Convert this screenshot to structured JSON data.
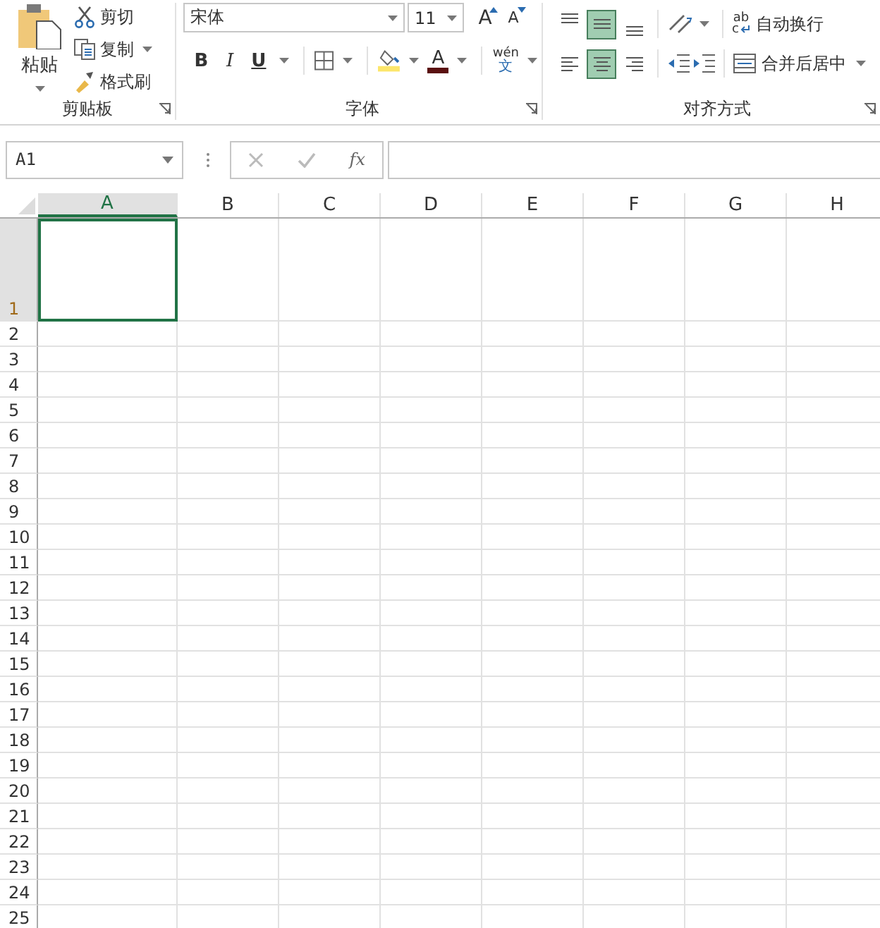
{
  "ribbon": {
    "clipboard": {
      "paste": {
        "label": "粘贴"
      },
      "cut": {
        "label": "剪切"
      },
      "copy": {
        "label": "复制"
      },
      "format_painter": {
        "label": "格式刷"
      },
      "group_label": "剪贴板"
    },
    "font": {
      "font_name": "宋体",
      "font_size": "11",
      "grow": "A",
      "shrink": "A",
      "bold": "B",
      "italic": "I",
      "underline": "U",
      "font_color": "A",
      "phonetic_top": "wén",
      "phonetic_bottom": "文",
      "group_label": "字体"
    },
    "alignment": {
      "vertical": [
        {
          "kind": "top",
          "selected": false
        },
        {
          "kind": "middle",
          "selected": true
        },
        {
          "kind": "bottom",
          "selected": false
        }
      ],
      "horizontal": [
        {
          "kind": "left",
          "selected": false
        },
        {
          "kind": "center",
          "selected": true
        },
        {
          "kind": "right",
          "selected": false
        }
      ],
      "wrap_text": {
        "icon_top": "ab",
        "icon_bottom": "c",
        "label": "自动换行"
      },
      "merge_center": {
        "label": "合并后居中"
      },
      "group_label": "对齐方式"
    }
  },
  "formula_bar": {
    "name_box": "A1",
    "fx": "fx"
  },
  "sheet": {
    "columns": [
      {
        "label": "A",
        "selected": true
      },
      {
        "label": "B",
        "selected": false
      },
      {
        "label": "C",
        "selected": false
      },
      {
        "label": "D",
        "selected": false
      },
      {
        "label": "E",
        "selected": false
      },
      {
        "label": "F",
        "selected": false
      },
      {
        "label": "G",
        "selected": false
      },
      {
        "label": "H",
        "selected": false
      }
    ],
    "rows": [
      {
        "label": "1",
        "selected": true
      },
      {
        "label": "2",
        "selected": false
      },
      {
        "label": "3",
        "selected": false
      },
      {
        "label": "4",
        "selected": false
      },
      {
        "label": "5",
        "selected": false
      },
      {
        "label": "6",
        "selected": false
      },
      {
        "label": "7",
        "selected": false
      },
      {
        "label": "8",
        "selected": false
      },
      {
        "label": "9",
        "selected": false
      },
      {
        "label": "10",
        "selected": false
      },
      {
        "label": "11",
        "selected": false
      },
      {
        "label": "12",
        "selected": false
      },
      {
        "label": "13",
        "selected": false
      },
      {
        "label": "14",
        "selected": false
      },
      {
        "label": "15",
        "selected": false
      },
      {
        "label": "16",
        "selected": false
      },
      {
        "label": "17",
        "selected": false
      },
      {
        "label": "18",
        "selected": false
      },
      {
        "label": "19",
        "selected": false
      },
      {
        "label": "20",
        "selected": false
      },
      {
        "label": "21",
        "selected": false
      },
      {
        "label": "22",
        "selected": false
      },
      {
        "label": "23",
        "selected": false
      },
      {
        "label": "24",
        "selected": false
      },
      {
        "label": "25",
        "selected": false
      }
    ]
  }
}
